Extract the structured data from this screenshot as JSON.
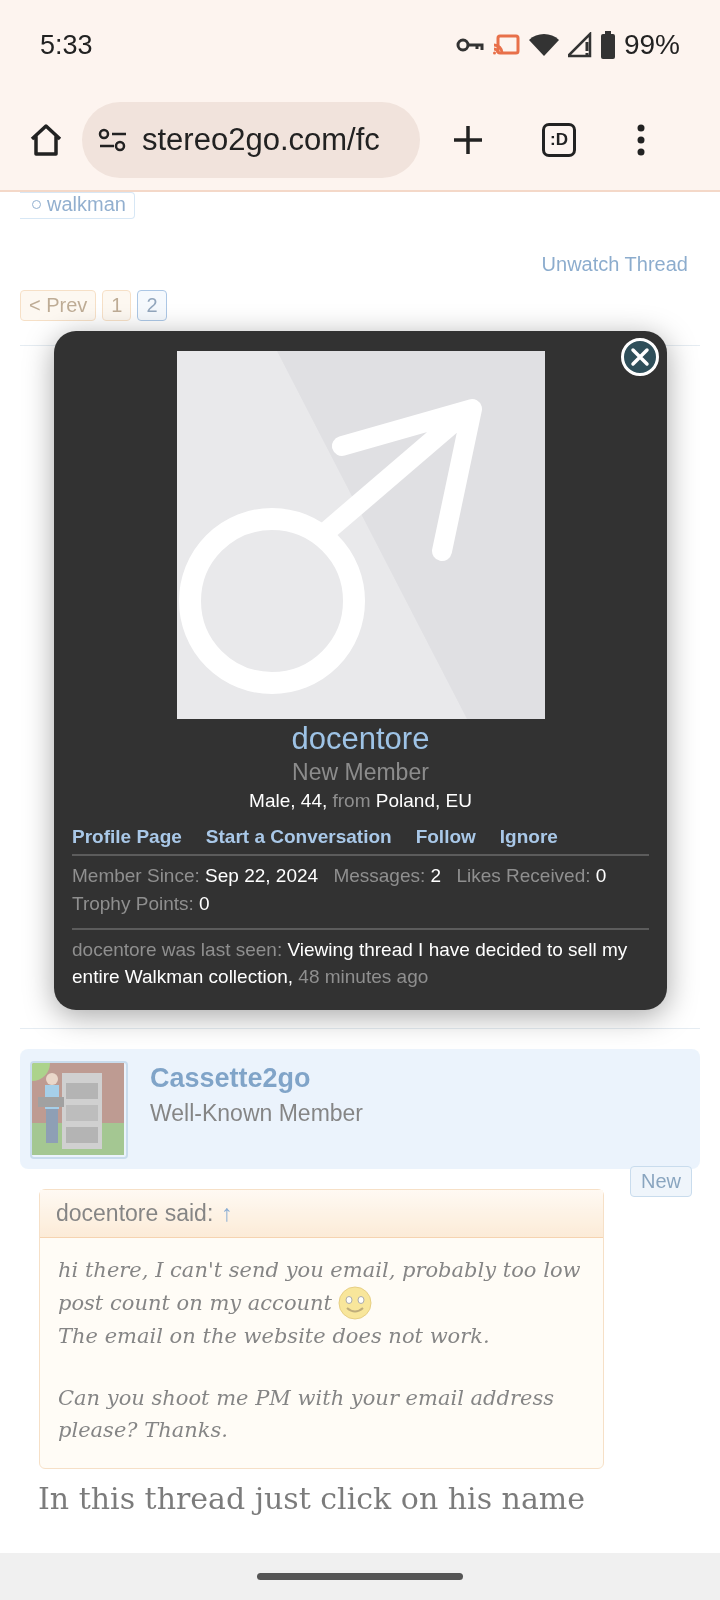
{
  "status_bar": {
    "time": "5:33",
    "battery": "99%"
  },
  "browser": {
    "url": "stereo2go.com/fc",
    "tab_switcher": ":D"
  },
  "tag": "walkman",
  "unwatch": "Unwatch Thread",
  "pagination": [
    {
      "label": "< Prev",
      "selected": false
    },
    {
      "label": "1",
      "selected": false
    },
    {
      "label": "2",
      "selected": true
    }
  ],
  "popup": {
    "name": "docentore",
    "title": "New Member",
    "info": [
      {
        "kind": "value",
        "text": "Male, 44,"
      },
      {
        "kind": "label",
        "text": "from"
      },
      {
        "kind": "value",
        "text": "Poland, EU"
      }
    ],
    "links": [
      "Profile Page",
      "Start a Conversation",
      "Follow",
      "Ignore"
    ],
    "stats": [
      {
        "label": "Member Since:",
        "value": "Sep 22, 2024"
      },
      {
        "label": "Messages:",
        "value": "2"
      },
      {
        "label": "Likes Received:",
        "value": "0"
      },
      {
        "label": "Trophy Points:",
        "value": "0"
      }
    ],
    "last_seen": {
      "label": "docentore was last seen:",
      "activity": "Viewing thread I have decided to sell my entire Walkman collection,",
      "time": "48 minutes ago"
    }
  },
  "post2": {
    "username": "Cassette2go",
    "role": "Well-Known Member",
    "badge": "New",
    "quote": {
      "author": "docentore said:",
      "arrow": "↑",
      "paragraphs": [
        {
          "lines": [
            {
              "text": "hi there, I can't send you email, probably too low",
              "smiley": false
            },
            {
              "text": "post count on my account",
              "smiley": true
            },
            {
              "text": "The email on the website does not work.",
              "smiley": false
            }
          ]
        },
        {
          "lines": [
            {
              "text": "Can you shoot me PM with your email address",
              "smiley": false
            },
            {
              "text": "please? Thanks.",
              "smiley": false
            }
          ]
        }
      ]
    },
    "body": "In this thread just click on his name"
  }
}
